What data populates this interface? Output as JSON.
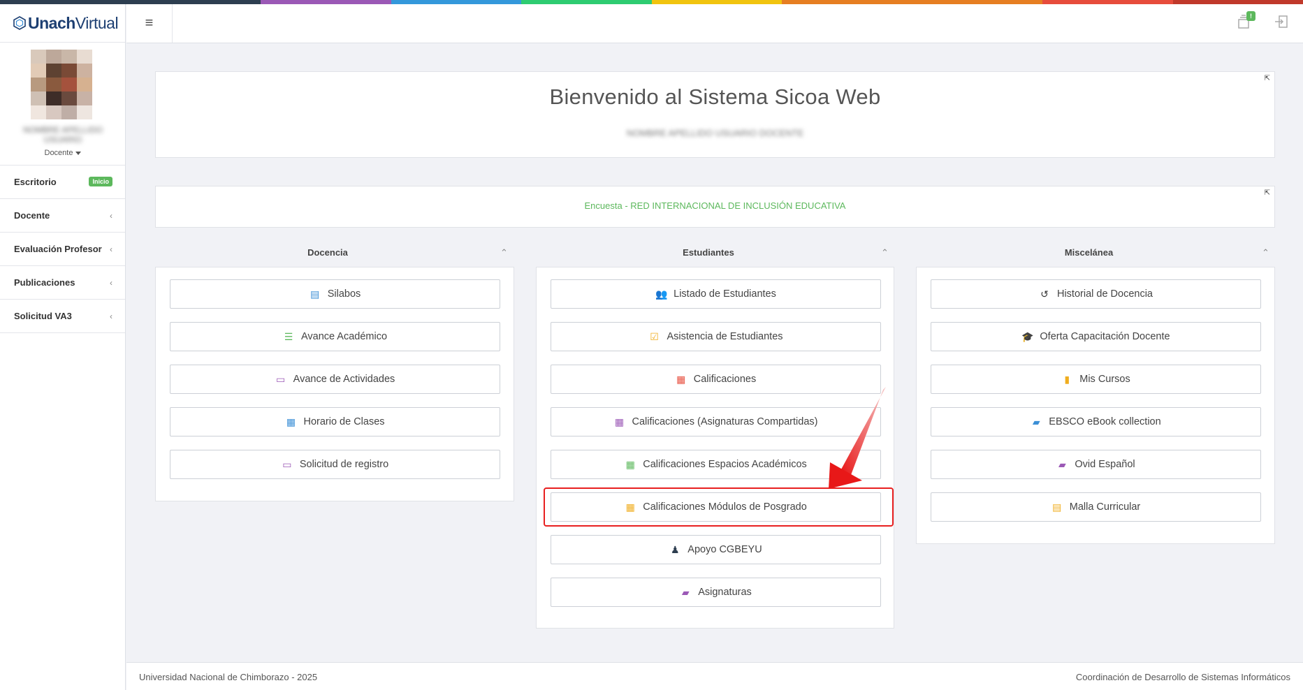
{
  "brand": {
    "strong": "Unach",
    "light": "Virtual"
  },
  "colors": {
    "strip": [
      "#2d3e50",
      "#2d3e50",
      "#9b59b6",
      "#3498db",
      "#2ecc71",
      "#f1c40f",
      "#e67e22",
      "#e67e22",
      "#e74c3c",
      "#c0392b"
    ],
    "accent_green": "#5cb85c",
    "highlight_red": "#e82020"
  },
  "user": {
    "name": "NOMBRE APELLIDO USUARIO",
    "role": "Docente"
  },
  "sidebar": {
    "items": [
      {
        "label": "Escritorio",
        "badge": "Inicio"
      },
      {
        "label": "Docente"
      },
      {
        "label": "Evaluación Profesor"
      },
      {
        "label": "Publicaciones"
      },
      {
        "label": "Solicitud VA3"
      }
    ]
  },
  "topbar": {
    "menu_icon": "hamburger-icon",
    "notif_badge": "!"
  },
  "welcome": {
    "title": "Bienvenido al Sistema Sicoa Web",
    "subtitle": "NOMBRE APELLIDO USUARIO DOCENTE"
  },
  "survey": {
    "prefix": "Encuesta - ",
    "label": "RED INTERNACIONAL DE INCLUSIÓN EDUCATIVA"
  },
  "columns": [
    {
      "title": "Docencia",
      "buttons": [
        {
          "label": "Silabos",
          "icon": "file-icon",
          "color": "#3b8fd6"
        },
        {
          "label": "Avance Académico",
          "icon": "list-icon",
          "color": "#5cb85c"
        },
        {
          "label": "Avance de Actividades",
          "icon": "card-icon",
          "color": "#9b59b6"
        },
        {
          "label": "Horario de Clases",
          "icon": "calendar-icon",
          "color": "#3b8fd6"
        },
        {
          "label": "Solicitud de registro",
          "icon": "card-icon",
          "color": "#9b59b6"
        }
      ]
    },
    {
      "title": "Estudiantes",
      "buttons": [
        {
          "label": "Listado de Estudiantes",
          "icon": "users-icon",
          "color": "#5cb85c"
        },
        {
          "label": "Asistencia de Estudiantes",
          "icon": "checkbox-icon",
          "color": "#f0ad1e"
        },
        {
          "label": "Calificaciones",
          "icon": "table-icon",
          "color": "#e74c3c"
        },
        {
          "label": "Calificaciones (Asignaturas Compartidas)",
          "icon": "table-icon",
          "color": "#9b59b6"
        },
        {
          "label": "Calificaciones Espacios Académicos",
          "icon": "table-icon",
          "color": "#5cb85c"
        },
        {
          "label": "Calificaciones Módulos de Posgrado",
          "icon": "table-icon",
          "color": "#f0ad1e"
        },
        {
          "label": "Apoyo CGBEYU",
          "icon": "person-icon",
          "color": "#2d3e50"
        },
        {
          "label": "Asignaturas",
          "icon": "book-icon",
          "color": "#9b59b6"
        }
      ]
    },
    {
      "title": "Miscelánea",
      "buttons": [
        {
          "label": "Historial de Docencia",
          "icon": "history-icon",
          "color": "#333333"
        },
        {
          "label": "Oferta Capacitación Docente",
          "icon": "graduation-cap-icon",
          "color": "#9b59b6"
        },
        {
          "label": "Mis Cursos",
          "icon": "bookmark-icon",
          "color": "#f0ad1e"
        },
        {
          "label": "EBSCO eBook collection",
          "icon": "book-icon",
          "color": "#3b8fd6"
        },
        {
          "label": "Ovid Español",
          "icon": "book-icon",
          "color": "#9b59b6"
        },
        {
          "label": "Malla Curricular",
          "icon": "file-icon",
          "color": "#f0ad1e"
        }
      ]
    }
  ],
  "footer": {
    "left": "Universidad Nacional de Chimborazo - 2025",
    "right": "Coordinación de Desarrollo de Sistemas Informáticos"
  }
}
